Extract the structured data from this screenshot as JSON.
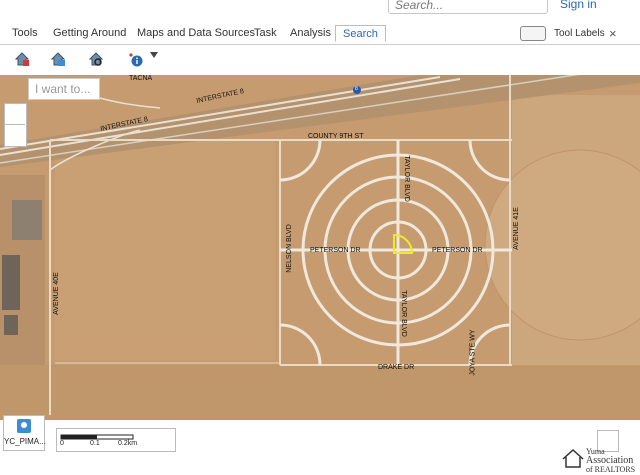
{
  "header": {
    "search_placeholder": "Search...",
    "signin": "Sign in"
  },
  "tabs": [
    {
      "label": "Tools",
      "active": false
    },
    {
      "label": "Getting Around",
      "active": false
    },
    {
      "label": "Maps and Data Sources",
      "active": false
    },
    {
      "label": "Task",
      "active": false
    },
    {
      "label": "Analysis",
      "active": false
    },
    {
      "label": "Search",
      "active": true
    }
  ],
  "tool_labels": "Tool Labels",
  "close": "×",
  "toolbar": {
    "icons": [
      "house-select-icon",
      "house-layers-icon",
      "house-search-icon",
      "info-icon"
    ]
  },
  "iwant": "I want to...",
  "map": {
    "labels": {
      "tacna": "TACNA",
      "interstate_top": "INTERSTATE 8",
      "interstate_left": "INTERSTATE 8",
      "county_9th": "COUNTY 9TH ST",
      "taylor_top": "TAYLOR BLVD",
      "taylor_bottom": "TAYLOR BLVD",
      "peterson_left": "PETERSON DR",
      "peterson_right": "PETERSON DR",
      "nelson": "NELSON BLVD",
      "avenue_41e": "AVENUE 41E",
      "avenue_40e": "AVENUE 40E",
      "drake": "DRAKE DR",
      "joyaste": "JOYA STE WY",
      "shield": "8"
    },
    "highlight_color": "#f1ea2a"
  },
  "layer_label": "YC_PIMA...",
  "scale": {
    "ticks": [
      "0",
      "0.1",
      "0.2km"
    ]
  },
  "brand": {
    "line1": "Yuma",
    "line2": "Association",
    "line3": "of REALTORS"
  }
}
